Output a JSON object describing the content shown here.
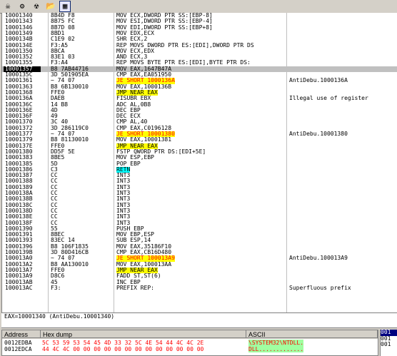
{
  "toolbar": {
    "buttons": [
      {
        "name": "run-icon",
        "glyph": "☠"
      },
      {
        "name": "cpu-icon",
        "glyph": "⚙"
      },
      {
        "name": "radiation-icon",
        "glyph": "☢"
      },
      {
        "name": "folder-icon",
        "glyph": "📂"
      },
      {
        "name": "breakpoints-icon",
        "glyph": "▦"
      }
    ]
  },
  "disasm": [
    {
      "addr": "10001340",
      "hex": "8B4D F8",
      "dis": "MOV ECX,DWORD PTR SS:[EBP-8]",
      "com": ""
    },
    {
      "addr": "10001343",
      "hex": "8B75 FC",
      "dis": "MOV ESI,DWORD PTR SS:[EBP-4]",
      "com": ""
    },
    {
      "addr": "10001346",
      "hex": "8B7D 08",
      "dis": "MOV EDI,DWORD PTR SS:[EBP+8]",
      "com": ""
    },
    {
      "addr": "10001349",
      "hex": "8BD1",
      "dis": "MOV EDX,ECX",
      "com": ""
    },
    {
      "addr": "1000134B",
      "hex": "C1E9 02",
      "dis": "SHR ECX,2",
      "com": ""
    },
    {
      "addr": "1000134E",
      "hex": "F3:A5",
      "dis": "REP MOVS DWORD PTR ES:[EDI],DWORD PTR DS",
      "com": ""
    },
    {
      "addr": "10001350",
      "hex": "8BCA",
      "dis": "MOV ECX,EDX",
      "com": ""
    },
    {
      "addr": "10001352",
      "hex": "83E1 03",
      "dis": "AND ECX,3",
      "com": ""
    },
    {
      "addr": "10001355",
      "hex": "F3:A4",
      "dis": "REP MOVS BYTE PTR ES:[EDI],BYTE PTR DS:",
      "com": ""
    },
    {
      "addr": "10001357",
      "hex": "B8 7AB44716",
      "dis": "MOV EAX,1647B47A",
      "com": ""
    },
    {
      "addr": "1000135C",
      "hex": "3D 501905EA",
      "dis": "CMP EAX,EA051950",
      "com": ""
    },
    {
      "addr": "10001361",
      "hex": "~ 74 07",
      "dis": "JE SHORT 1000136A",
      "com": "AntiDebu.1000136A"
    },
    {
      "addr": "10001363",
      "hex": "B8 6B130010",
      "dis": "MOV EAX,1000136B",
      "com": ""
    },
    {
      "addr": "10001368",
      "hex": "FFE0",
      "dis": "JMP NEAR EAX",
      "com": ""
    },
    {
      "addr": "1000136A",
      "hex": "DAEB",
      "dis": "FISUBR EBX",
      "com": "Illegal use of register"
    },
    {
      "addr": "1000136C",
      "hex": "14 B8",
      "dis": "ADC AL,0B8",
      "com": ""
    },
    {
      "addr": "1000136E",
      "hex": "4D",
      "dis": "DEC EBP",
      "com": ""
    },
    {
      "addr": "1000136F",
      "hex": "49",
      "dis": "DEC ECX",
      "com": ""
    },
    {
      "addr": "10001370",
      "hex": "3C 40",
      "dis": "CMP AL,40",
      "com": ""
    },
    {
      "addr": "10001372",
      "hex": "3D 286119C0",
      "dis": "CMP EAX,C0196128",
      "com": ""
    },
    {
      "addr": "10001377",
      "hex": "~ 74 07",
      "dis": "JE SHORT 10001380",
      "com": "AntiDebu.10001380"
    },
    {
      "addr": "10001379",
      "hex": "B8 81130010",
      "dis": "MOV EAX,10001381",
      "com": ""
    },
    {
      "addr": "1000137E",
      "hex": "FFE0",
      "dis": "JMP NEAR EAX",
      "com": ""
    },
    {
      "addr": "10001380",
      "hex": "DD5F 5E",
      "dis": "FSTP QWORD PTR DS:[EDI+5E]",
      "com": ""
    },
    {
      "addr": "10001383",
      "hex": "8BE5",
      "dis": "MOV ESP,EBP",
      "com": ""
    },
    {
      "addr": "10001385",
      "hex": "5D",
      "dis": "POP EBP",
      "com": ""
    },
    {
      "addr": "10001386",
      "hex": "C3",
      "dis": "RETN",
      "com": ""
    },
    {
      "addr": "10001387",
      "hex": "CC",
      "dis": "INT3",
      "com": ""
    },
    {
      "addr": "10001388",
      "hex": "CC",
      "dis": "INT3",
      "com": ""
    },
    {
      "addr": "10001389",
      "hex": "CC",
      "dis": "INT3",
      "com": ""
    },
    {
      "addr": "1000138A",
      "hex": "CC",
      "dis": "INT3",
      "com": ""
    },
    {
      "addr": "1000138B",
      "hex": "CC",
      "dis": "INT3",
      "com": ""
    },
    {
      "addr": "1000138C",
      "hex": "CC",
      "dis": "INT3",
      "com": ""
    },
    {
      "addr": "1000138D",
      "hex": "CC",
      "dis": "INT3",
      "com": ""
    },
    {
      "addr": "1000138E",
      "hex": "CC",
      "dis": "INT3",
      "com": ""
    },
    {
      "addr": "1000138F",
      "hex": "CC",
      "dis": "INT3",
      "com": ""
    },
    {
      "addr": "10001390",
      "hex": "55",
      "dis": "PUSH EBP",
      "com": ""
    },
    {
      "addr": "10001391",
      "hex": "8BEC",
      "dis": "MOV EBP,ESP",
      "com": ""
    },
    {
      "addr": "10001393",
      "hex": "83EC 14",
      "dis": "SUB ESP,14",
      "com": ""
    },
    {
      "addr": "10001396",
      "hex": "B8 106F1835",
      "dis": "MOV EAX,35186F10",
      "com": ""
    },
    {
      "addr": "1000139B",
      "hex": "3D 80D416CB",
      "dis": "CMP EAX,CB16D480",
      "com": ""
    },
    {
      "addr": "100013A0",
      "hex": "~ 74 07",
      "dis": "JE SHORT 100013A9",
      "com": "AntiDebu.100013A9"
    },
    {
      "addr": "100013A2",
      "hex": "B8 AA130010",
      "dis": "MOV EAX,100013AA",
      "com": ""
    },
    {
      "addr": "100013A7",
      "hex": "FFE0",
      "dis": "JMP NEAR EAX",
      "com": ""
    },
    {
      "addr": "100013A9",
      "hex": "D8C6",
      "dis": "FADD ST,ST(6)",
      "com": ""
    },
    {
      "addr": "100013AB",
      "hex": "45",
      "dis": "INC EBP",
      "com": ""
    },
    {
      "addr": "100013AC",
      "hex": "F3:",
      "dis": "PREFIX REP:",
      "com": "Superfluous prefix"
    }
  ],
  "info": {
    "text": "EAX=10001340 (AntiDebu.10001340)"
  },
  "dump": {
    "headers": {
      "address": "Address",
      "hex": "Hex dump",
      "ascii": "ASCII"
    },
    "rows": [
      {
        "addr": "0012EDBA",
        "hex": "5C 53 59 53 54 45 4D 33 32 5C 4E 54 44 4C 4C 2E",
        "ascii": "\\SYSTEM32\\NTDLL."
      },
      {
        "addr": "0012EDCA",
        "hex": "44 4C 4C 00 00 00 00 00 00 00 00 00 00 00 00 00",
        "ascii": "DLL............."
      }
    ]
  },
  "stack": [
    "001",
    "001",
    "001"
  ]
}
